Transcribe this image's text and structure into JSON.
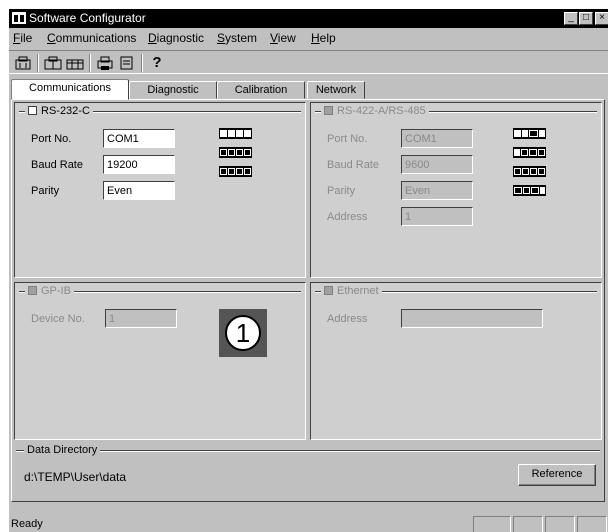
{
  "window": {
    "title": "Software Configurator",
    "controls": {
      "minimize": "_",
      "maximize": "□",
      "close": "×"
    }
  },
  "menu": [
    {
      "label": "File",
      "mnemonic": "F",
      "rest": "ile"
    },
    {
      "label": "Communications",
      "mnemonic": "C",
      "rest": "ommunications"
    },
    {
      "label": "Diagnostic",
      "mnemonic": "D",
      "rest": "iagnostic"
    },
    {
      "label": "System",
      "mnemonic": "S",
      "rest": "ystem"
    },
    {
      "label": "View",
      "mnemonic": "V",
      "rest": "iew"
    },
    {
      "label": "Help",
      "mnemonic": "H",
      "rest": "elp"
    }
  ],
  "toolbar": {
    "icons": [
      "instrument-icon",
      "instrument-pair-icon",
      "instrument-group-icon",
      "print-icon",
      "preview-icon",
      "help-icon"
    ],
    "glyphs": [
      "⌂",
      "⌂⌂",
      "⌂⌂",
      "⎙",
      "⌂",
      "?"
    ]
  },
  "tabs": [
    "Communications",
    "Diagnostic",
    "Calibration",
    "Network"
  ],
  "active_tab": "Communications",
  "rs232": {
    "title": "RS-232-C",
    "enabled": true,
    "port_label": "Port No.",
    "port_value": "COM1",
    "baud_label": "Baud Rate",
    "baud_value": "19200",
    "parity_label": "Parity",
    "parity_value": "Even"
  },
  "rs485": {
    "title": "RS-422-A/RS-485",
    "enabled": false,
    "port_label": "Port No.",
    "port_value": "COM1",
    "baud_label": "Baud Rate",
    "baud_value": "9600",
    "parity_label": "Parity",
    "parity_value": "Even",
    "address_label": "Address",
    "address_value": "1"
  },
  "gpib": {
    "title": "GP-IB",
    "enabled": false,
    "device_label": "Device No.",
    "device_value": "1",
    "badge": "1"
  },
  "ethernet": {
    "title": "Ethernet",
    "enabled": false,
    "address_label": "Address",
    "address_value": ""
  },
  "data_directory": {
    "title": "Data Directory",
    "path": "d:\\TEMP\\User\\data",
    "button": "Reference"
  },
  "status": {
    "text": "Ready"
  }
}
